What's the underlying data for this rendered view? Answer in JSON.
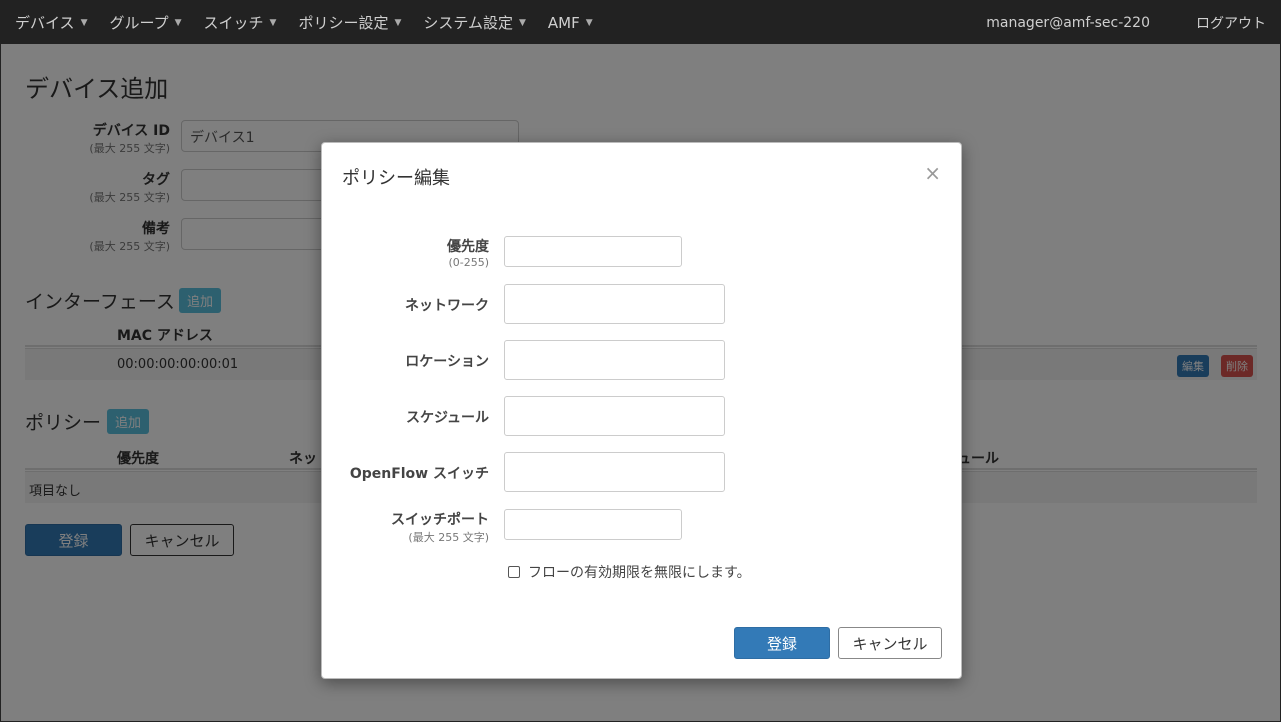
{
  "nav": {
    "items": [
      {
        "label": "デバイス"
      },
      {
        "label": "グループ"
      },
      {
        "label": "スイッチ"
      },
      {
        "label": "ポリシー設定"
      },
      {
        "label": "システム設定"
      },
      {
        "label": "AMF"
      }
    ],
    "user": "manager@amf-sec-220",
    "logout": "ログアウト"
  },
  "page": {
    "title": "デバイス追加",
    "fields": [
      {
        "label": "デバイス ID",
        "hint": "(最大 255 文字)",
        "value": "デバイス1"
      },
      {
        "label": "タグ",
        "hint": "(最大 255 文字)",
        "value": ""
      },
      {
        "label": "備考",
        "hint": "(最大 255 文字)",
        "value": ""
      }
    ],
    "interfaces": {
      "title": "インターフェース",
      "add_label": "追加",
      "header_mac": "MAC アドレス",
      "rows": [
        {
          "mac": "00:00:00:00:00:01"
        }
      ],
      "edit_label": "編集",
      "delete_label": "削除"
    },
    "policies": {
      "title": "ポリシー",
      "add_label": "追加",
      "header_priority": "優先度",
      "header_network": "ネッ",
      "header_schedule": "ュール",
      "empty_text": "項目なし"
    },
    "submit_label": "登録",
    "cancel_label": "キャンセル"
  },
  "modal": {
    "title": "ポリシー編集",
    "close": "×",
    "fields": [
      {
        "label": "優先度",
        "hint": "(0-255)"
      },
      {
        "label": "ネットワーク",
        "hint": ""
      },
      {
        "label": "ロケーション",
        "hint": ""
      },
      {
        "label": "スケジュール",
        "hint": ""
      },
      {
        "label": "OpenFlow スイッチ",
        "hint": ""
      },
      {
        "label": "スイッチポート",
        "hint": "(最大 255 文字)"
      }
    ],
    "checkbox_label": "フローの有効期限を無限にします。",
    "submit_label": "登録",
    "cancel_label": "キャンセル"
  },
  "colors": {
    "navbar": "#222222",
    "primary": "#337ab7",
    "info": "#5bc0de",
    "danger": "#d9534f"
  }
}
